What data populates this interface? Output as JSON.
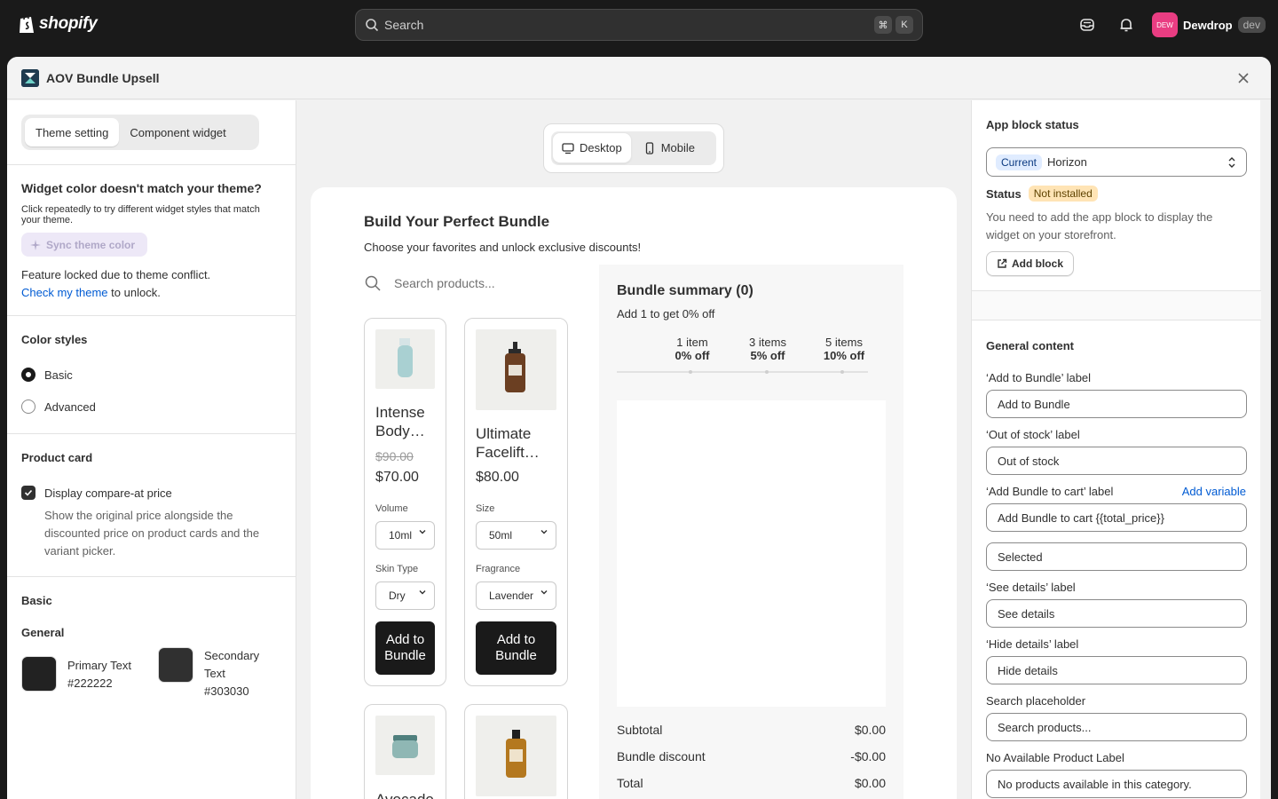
{
  "topbar": {
    "brand": "shopify",
    "search_placeholder": "Search",
    "kbd_cmd": "⌘",
    "kbd_k": "K",
    "avatar_initials": "DEW",
    "user_name": "Dewdrop",
    "user_badge": "dev"
  },
  "modal": {
    "title": "AOV Bundle Upsell"
  },
  "left_panel": {
    "tabs": [
      "Theme setting",
      "Component widget"
    ],
    "mismatch_title": "Widget color doesn't match your theme?",
    "mismatch_text": "Click repeatedly to try different widget styles that match your theme.",
    "sync_button": "Sync theme color",
    "locked_text": "Feature locked due to theme conflict.",
    "check_link": "Check my theme",
    "unlock_text": "to unlock.",
    "color_styles_title": "Color styles",
    "color_styles": [
      {
        "label": "Basic",
        "selected": true
      },
      {
        "label": "Advanced",
        "selected": false
      }
    ],
    "product_card_title": "Product card",
    "compare_label": "Display compare-at price",
    "compare_checked": true,
    "compare_help": "Show the original price alongside the discounted price on product cards and the variant picker.",
    "basic_title": "Basic",
    "general_title": "General",
    "swatches": [
      {
        "label": "Primary Text",
        "value": "#222222"
      },
      {
        "label": "Secondary Text",
        "value": "#303030"
      }
    ]
  },
  "device_toggle": {
    "desktop": "Desktop",
    "mobile": "Mobile",
    "active": "Desktop"
  },
  "preview": {
    "title": "Build Your Perfect Bundle",
    "subtitle": "Choose your favorites and unlock exclusive discounts!",
    "search_placeholder": "Search products...",
    "products": [
      {
        "name_line1": "Intense",
        "name_line2": "Body…",
        "compare_price": "$90.00",
        "price": "$70.00",
        "option1_label": "Volume",
        "option1_value": "10ml",
        "option2_label": "Skin Type",
        "option2_value": "Dry",
        "button_line1": "Add to",
        "button_line2": "Bundle"
      },
      {
        "name_line1": "Ultimate",
        "name_line2": "Facelift…",
        "price": "$80.00",
        "option1_label": "Size",
        "option1_value": "50ml",
        "option2_label": "Fragrance",
        "option2_value": "Lavender",
        "button_line1": "Add to",
        "button_line2": "Bundle"
      },
      {
        "name_line1": "Avocado"
      },
      {
        "name_line1": ""
      }
    ],
    "summary": {
      "title": "Bundle summary (0)",
      "subtitle": "Add 1 to get 0% off",
      "tiers": [
        {
          "qty": "1 item",
          "discount": "0% off"
        },
        {
          "qty": "3 items",
          "discount": "5% off"
        },
        {
          "qty": "5 items",
          "discount": "10% off"
        }
      ],
      "subtotal_label": "Subtotal",
      "subtotal_value": "$0.00",
      "discount_label": "Bundle discount",
      "discount_value": "-$0.00",
      "total_label": "Total",
      "total_value": "$0.00"
    }
  },
  "right_panel": {
    "app_block_title": "App block status",
    "current_badge": "Current",
    "theme_name": "Horizon",
    "status_label": "Status",
    "status_value": "Not installed",
    "status_help": "You need to add the app block to display the widget on your storefront.",
    "add_block_button": "Add block",
    "general_content_title": "General content",
    "fields": {
      "add_to_bundle_label": "‘Add to Bundle’ label",
      "add_to_bundle_value": "Add to Bundle",
      "out_of_stock_label": "‘Out of stock’ label",
      "out_of_stock_value": "Out of stock",
      "add_bundle_cart_label": "‘Add Bundle to cart’ label",
      "add_variable_link": "Add variable",
      "add_bundle_cart_value": "Add Bundle to cart {{total_price}}",
      "selected_value": "Selected",
      "see_details_label": "‘See details’ label",
      "see_details_value": "See details",
      "hide_details_label": "‘Hide details’ label",
      "hide_details_value": "Hide details",
      "search_placeholder_label": "Search placeholder",
      "search_placeholder_value": "Search products...",
      "no_product_label": "No Available Product Label",
      "no_product_value": "No products available in this category."
    }
  },
  "colors": {
    "topbar_bg": "#1a1a1a",
    "accent_link": "#005bd3",
    "avatar": "#e93d82",
    "button_dark": "#1a1a1a",
    "status_warning": "#ffe4b5"
  }
}
